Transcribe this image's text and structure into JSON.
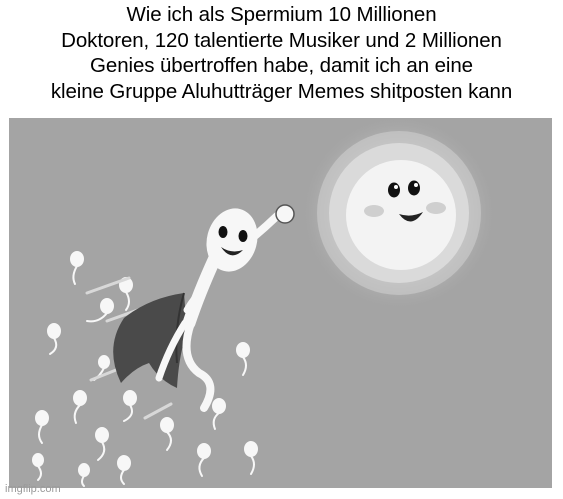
{
  "caption": {
    "lines": [
      "Wie ich als Spermium 10 Millionen",
      "Doktoren, 120 talentierte Musiker und 2 Millionen",
      "Genies übertroffen habe, damit ich an eine",
      "kleine Gruppe Aluhutträger Memes shitposten kann"
    ]
  },
  "watermark": "imgflip.com",
  "colors": {
    "background": "#a4a4a4",
    "egg": "#f3f3f3",
    "cape": "#4a4a4a",
    "sperm": "#f7f7f7"
  }
}
